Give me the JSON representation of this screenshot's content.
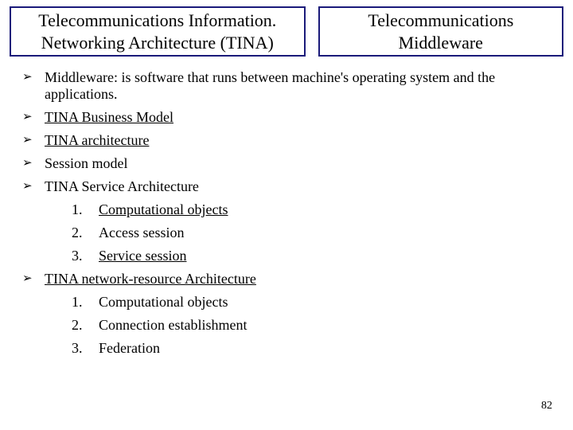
{
  "header": {
    "left": "Telecommunications Information. Networking Architecture (TINA)",
    "right_line1": "Telecommunications",
    "right_line2": "Middleware"
  },
  "bullets": [
    {
      "text": " Middleware: is software that runs between machine's operating system and the applications.",
      "underline": false
    },
    {
      "text": " TINA Business Model",
      "underline": true
    },
    {
      "text": " TINA architecture",
      "underline": true
    },
    {
      "text": " Session model",
      "underline": false
    },
    {
      "text": " TINA Service Architecture",
      "underline": false
    }
  ],
  "sublist1": [
    {
      "num": "1.",
      "text": "Computational objects",
      "underline": true
    },
    {
      "num": "2.",
      "text": "Access session",
      "underline": false
    },
    {
      "num": "3.",
      "text": "Service session",
      "underline": true
    }
  ],
  "bullet6": {
    "text": "TINA network-resource Architecture",
    "underline": true
  },
  "sublist2": [
    {
      "num": "1.",
      "text": "Computational objects",
      "underline": false
    },
    {
      "num": "2.",
      "text": "Connection establishment",
      "underline": false
    },
    {
      "num": "3.",
      "text": "Federation",
      "underline": false
    }
  ],
  "page": "82",
  "arrow": "➢"
}
